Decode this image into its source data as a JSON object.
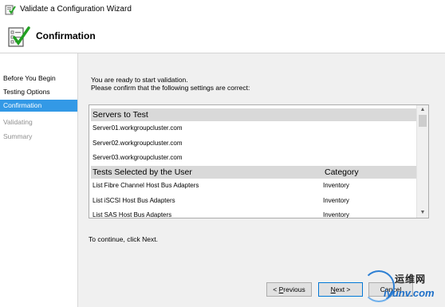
{
  "window": {
    "title": "Validate a Configuration Wizard"
  },
  "header": {
    "heading": "Confirmation",
    "icon": "checklist-icon"
  },
  "sidebar": {
    "items": [
      {
        "label": "Before You Begin",
        "state": "normal"
      },
      {
        "label": "Testing Options",
        "state": "normal"
      },
      {
        "label": "Confirmation",
        "state": "active"
      },
      {
        "label": "Validating",
        "state": "disabled"
      },
      {
        "label": "Summary",
        "state": "disabled"
      }
    ]
  },
  "main": {
    "intro_line1": "You are ready to start validation.",
    "intro_line2": "Please confirm that the following settings are correct:",
    "servers_header": "Servers to Test",
    "servers": [
      "Server01.workgroupcluster.com",
      "Server02.workgroupcluster.com",
      "Server03.workgroupcluster.com"
    ],
    "tests_header": "Tests Selected by the User",
    "category_header": "Category",
    "tests": [
      {
        "name": "List Fibre Channel Host Bus Adapters",
        "category": "Inventory"
      },
      {
        "name": "List iSCSI Host Bus Adapters",
        "category": "Inventory"
      },
      {
        "name": "List SAS Host Bus Adapters",
        "category": "Inventory"
      }
    ],
    "continue_text": "To continue, click Next."
  },
  "buttons": {
    "previous_prefix": "< ",
    "previous_key": "P",
    "previous_rest": "revious",
    "next_key": "N",
    "next_rest": "ext >",
    "cancel": "Cancel"
  },
  "watermark": {
    "cn": "运维网",
    "en": "iyunv.com"
  },
  "colors": {
    "accent": "#3399e6",
    "list_header_bg": "#d9d9d9",
    "panel_bg": "#f0f0f0"
  }
}
